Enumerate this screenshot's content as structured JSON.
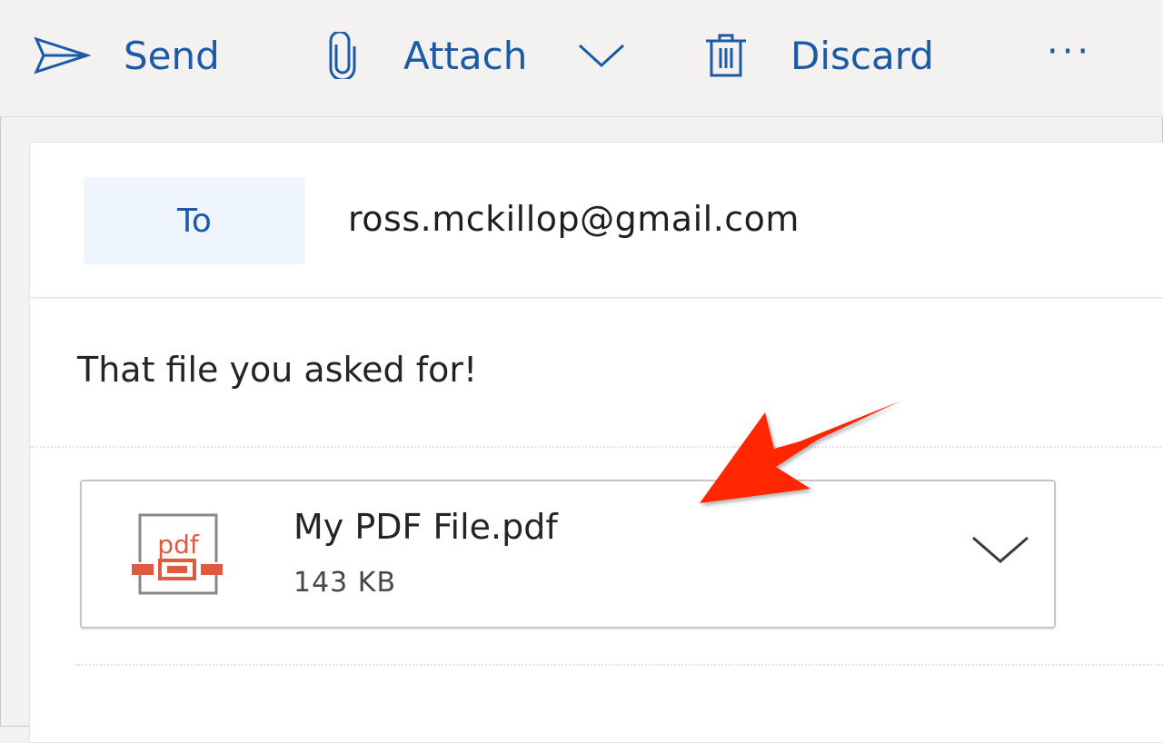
{
  "toolbar": {
    "send_label": "Send",
    "attach_label": "Attach",
    "discard_label": "Discard",
    "more_label": "···",
    "icons": {
      "send": "send-paper-plane-icon",
      "attach": "paperclip-icon",
      "attach_dropdown": "chevron-down-icon",
      "discard": "trash-icon",
      "more": "more-ellipsis-icon"
    }
  },
  "compose": {
    "to_label": "To",
    "to_value": "ross.mckillop@gmail.com",
    "body_text": "That file you asked for!"
  },
  "attachment": {
    "file_name": "My PDF File.pdf",
    "file_size": "143 KB",
    "icon_text": "pdf",
    "icon": "pdf-file-icon",
    "menu_icon": "chevron-down-icon"
  },
  "annotation": {
    "type": "red-arrow",
    "color": "#ff2600",
    "points_to": "attachment"
  },
  "colors": {
    "accent": "#1b5aa6",
    "toolbar_bg": "#f3f2f1",
    "to_chip_bg": "#eff5fc",
    "pdf_red": "#e05a40"
  }
}
